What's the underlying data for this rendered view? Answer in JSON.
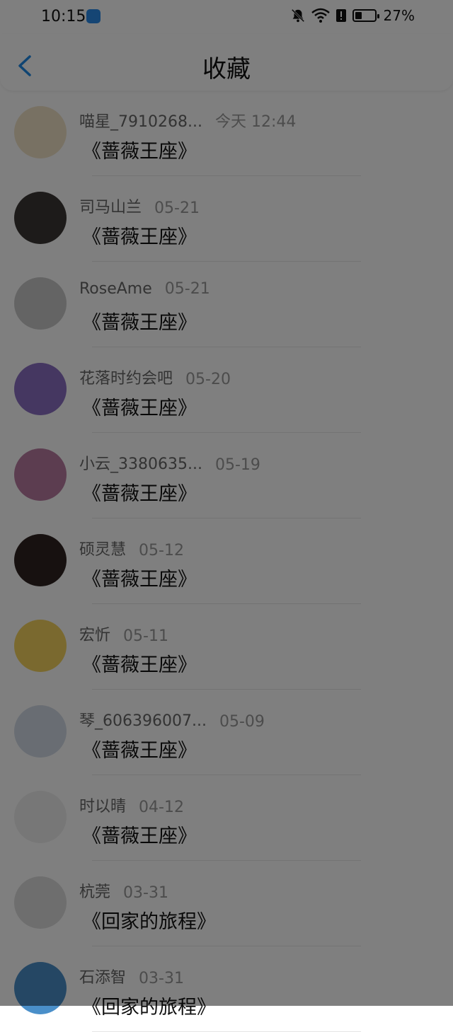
{
  "status_bar": {
    "time": "10:15",
    "battery": "27%"
  },
  "header": {
    "title": "收藏"
  },
  "favorites": [
    {
      "name": "喵星_7910268...",
      "time": "今天 12:44",
      "work": "《蔷薇王座》",
      "avatar_color": "#f1e2c7"
    },
    {
      "name": "司马山兰",
      "time": "05-21",
      "work": "《蔷薇王座》",
      "avatar_color": "#3a3634"
    },
    {
      "name": "RoseAme",
      "time": "05-21",
      "work": "《蔷薇王座》",
      "avatar_color": "#c9c9c9"
    },
    {
      "name": "花落时约会吧",
      "time": "05-20",
      "work": "《蔷薇王座》",
      "avatar_color": "#8a6fc2"
    },
    {
      "name": "小云_3380635...",
      "time": "05-19",
      "work": "《蔷薇王座》",
      "avatar_color": "#b97aa0"
    },
    {
      "name": "硕灵慧",
      "time": "05-12",
      "work": "《蔷薇王座》",
      "avatar_color": "#2e2320"
    },
    {
      "name": "宏忻",
      "time": "05-11",
      "work": "《蔷薇王座》",
      "avatar_color": "#f4d35e"
    },
    {
      "name": "琴_606396007...",
      "time": "05-09",
      "work": "《蔷薇王座》",
      "avatar_color": "#d2dbe6"
    },
    {
      "name": "时以晴",
      "time": "04-12",
      "work": "《蔷薇王座》",
      "avatar_color": "#eeeeee"
    },
    {
      "name": "杭莞",
      "time": "03-31",
      "work": "《回家的旅程》",
      "avatar_color": "#dcdcdc"
    },
    {
      "name": "石添智",
      "time": "03-31",
      "work": "《回家的旅程》",
      "avatar_color": "#4a8fc9"
    }
  ],
  "colors": {
    "accent": "#1e88e5",
    "overlay": "rgba(0,0,0,0.5)"
  },
  "icons": [
    "app-notification-icon",
    "mute-bell-icon",
    "wifi-icon",
    "alert-icon",
    "battery-icon",
    "back-chevron-icon"
  ]
}
